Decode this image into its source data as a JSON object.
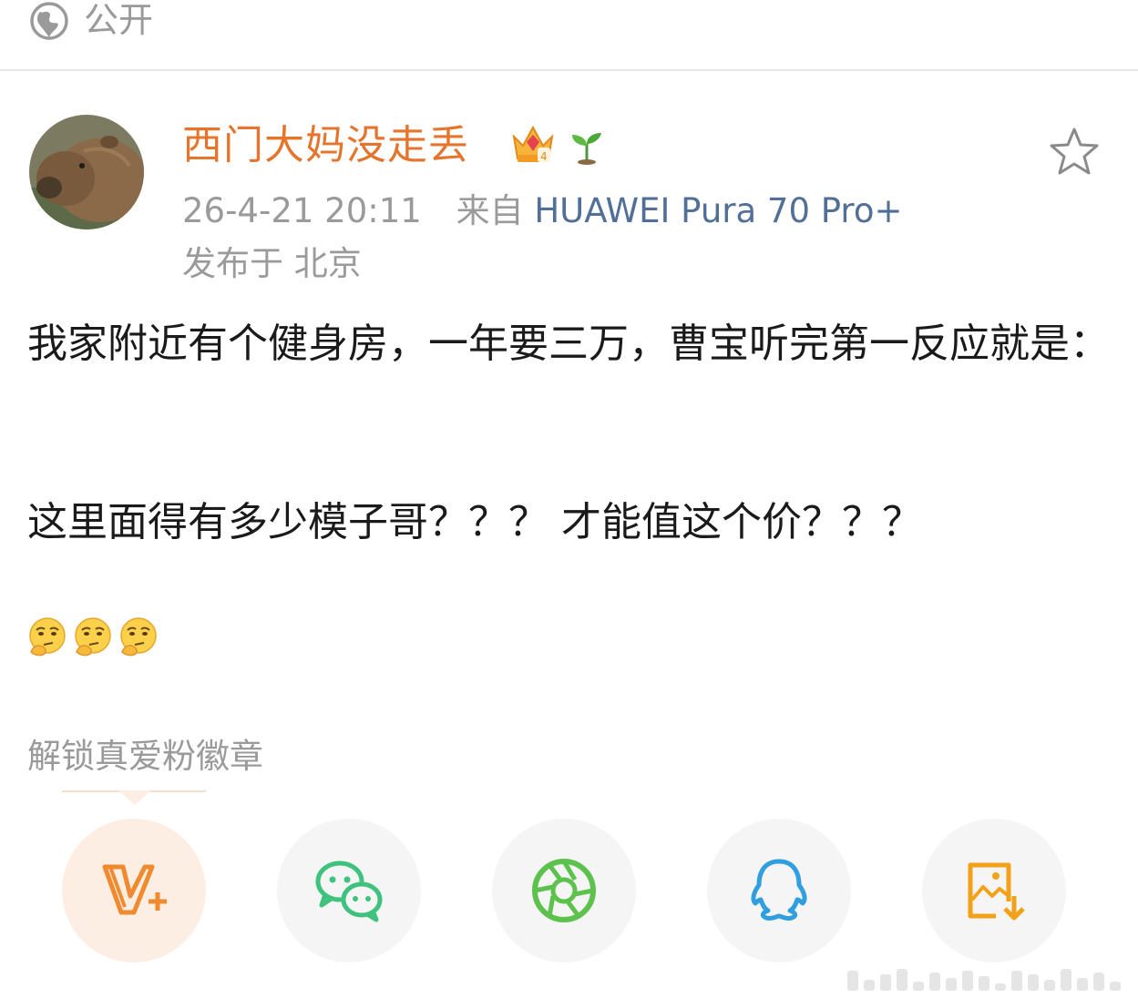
{
  "header": {
    "visibility_label": "公开",
    "icon": "globe-icon"
  },
  "post": {
    "author": {
      "name": "西门大妈没走丢",
      "avatar_icon": "capybara-avatar",
      "badges": [
        "crown-level-4-icon",
        "sprout-icon"
      ]
    },
    "timestamp": "26-4-21 20:11",
    "source_prefix": "来自",
    "device": "HUAWEI Pura 70 Pro+",
    "location": "发布于 北京",
    "favorite_icon": "star-outline-icon",
    "body_line": "我家附近有个健身房，一年要三万，曹宝听完第一反应就是：",
    "question_line": "这里面得有多少模子哥？？？ 才能值这个价？？？",
    "emojis": [
      "thinking-face-icon",
      "thinking-face-icon",
      "thinking-face-icon"
    ]
  },
  "actions": {
    "fan_badge_label": "解锁真爱粉徽章",
    "share_targets": [
      {
        "name": "vplus",
        "icon": "v-plus-icon",
        "color": "#f08a2e"
      },
      {
        "name": "wechat",
        "icon": "wechat-icon",
        "color": "#3fc27e"
      },
      {
        "name": "moments",
        "icon": "moments-aperture-icon",
        "color": "#5dc24d"
      },
      {
        "name": "qq",
        "icon": "qq-penguin-icon",
        "color": "#2f9fe0"
      },
      {
        "name": "save-image",
        "icon": "save-image-icon",
        "color": "#f3a118"
      }
    ]
  },
  "colors": {
    "username": "#e5742c",
    "device": "#516f97",
    "muted": "#9a9a9a"
  }
}
